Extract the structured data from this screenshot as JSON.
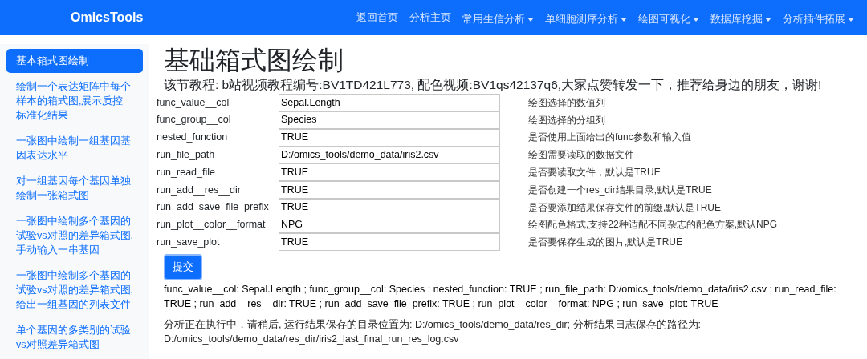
{
  "navbar": {
    "brand": "OmicsTools",
    "items": [
      {
        "label": "返回首页",
        "kind": "link"
      },
      {
        "label": "分析主页",
        "kind": "link"
      },
      {
        "label": "常用生信分析",
        "kind": "dropdown"
      },
      {
        "label": "单细胞测序分析",
        "kind": "dropdown"
      },
      {
        "label": "绘图可视化",
        "kind": "dropdown"
      },
      {
        "label": "数据库挖掘",
        "kind": "dropdown"
      },
      {
        "label": "分析插件拓展",
        "kind": "dropdown"
      }
    ]
  },
  "sidebar": {
    "items": [
      {
        "label": "基本箱式图绘制",
        "selected": true
      },
      {
        "label": "绘制一个表达矩阵中每个样本的箱式图,展示质控标准化结果",
        "selected": false
      },
      {
        "label": "一张图中绘制一组基因基因表达水平",
        "selected": false
      },
      {
        "label": "对一组基因每个基因单独绘制一张箱式图",
        "selected": false
      },
      {
        "label": "一张图中绘制多个基因的试验vs对照的差异箱式图,手动输入一串基因",
        "selected": false
      },
      {
        "label": "一张图中绘制多个基因的试验vs对照的差异箱式图,给出一组基因的列表文件",
        "selected": false
      },
      {
        "label": "单个基因的多类别的试验vs对照差异箱式图",
        "selected": false
      }
    ]
  },
  "page": {
    "title": "基础箱式图绘制",
    "subtitle": "该节教程: b站视频教程编号:BV1TD421L773, 配色视频:BV1qs42137q6,大家点赞转发一下，推荐给身边的朋友，谢谢!",
    "params": [
      {
        "name": "func_value__col",
        "value": "Sepal.Length",
        "description": "绘图选择的数值列"
      },
      {
        "name": "func_group__col",
        "value": "Species",
        "description": "绘图选择的分组列"
      },
      {
        "name": "nested_function",
        "value": "TRUE",
        "description": "是否使用上面给出的func参数和输入值"
      },
      {
        "name": "run_file_path",
        "value": "D:/omics_tools/demo_data/iris2.csv",
        "description": "绘图需要读取的数据文件"
      },
      {
        "name": "run_read_file",
        "value": "TRUE",
        "description": "是否要读取文件，默认是TRUE"
      },
      {
        "name": "run_add__res__dir",
        "value": "TRUE",
        "description": "是否创建一个res_dir结果目录,默认是TRUE"
      },
      {
        "name": "run_add_save_file_prefix",
        "value": "TRUE",
        "description": "是否要添加结果保存文件的前缀,默认是TRUE"
      },
      {
        "name": "run_plot__color__format",
        "value": "NPG",
        "description": "绘图配色格式,支持22种适配不同杂志的配色方案,默认NPG"
      },
      {
        "name": "run_save_plot",
        "value": "TRUE",
        "description": "是否要保存生成的图片,默认是TRUE"
      }
    ],
    "submit": "提交",
    "summary": "func_value__col: Sepal.Length ; func_group__col: Species ; nested_function: TRUE ; run_file_path: D:/omics_tools/demo_data/iris2.csv ; run_read_file: TRUE ; run_add__res__dir: TRUE ; run_add_save_file_prefix: TRUE ; run_plot__color__format: NPG ; run_save_plot: TRUE",
    "status": "分析正在执行中，请稍后, 运行结果保存的目录位置为: D:/omics_tools/demo_data/res_dir; 分析结果日志保存的路径为: D:/omics_tools/demo_data/res_dir/iris2_last_final_run_res_log.csv"
  }
}
